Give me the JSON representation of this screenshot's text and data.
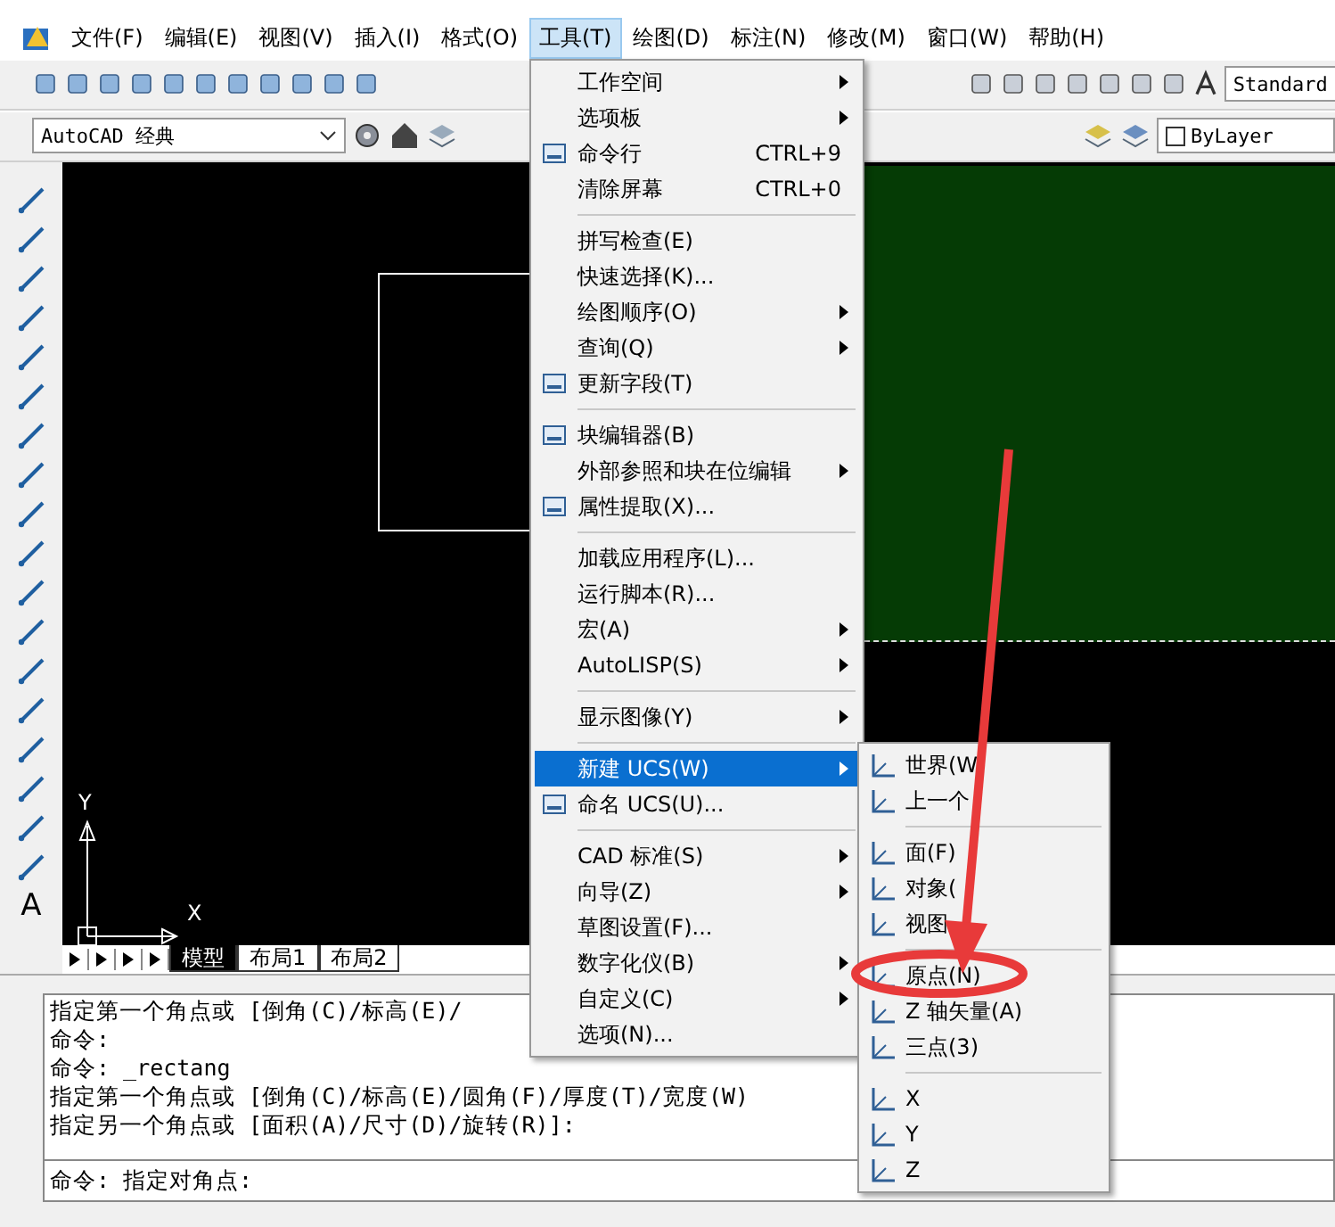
{
  "menu_bar": [
    {
      "label": "文件(F)",
      "selected": false
    },
    {
      "label": "编辑(E)",
      "selected": false
    },
    {
      "label": "视图(V)",
      "selected": false
    },
    {
      "label": "插入(I)",
      "selected": false
    },
    {
      "label": "格式(O)",
      "selected": false
    },
    {
      "label": "工具(T)",
      "selected": true
    },
    {
      "label": "绘图(D)",
      "selected": false
    },
    {
      "label": "标注(N)",
      "selected": false
    },
    {
      "label": "修改(M)",
      "selected": false
    },
    {
      "label": "窗口(W)",
      "selected": false
    },
    {
      "label": "帮助(H)",
      "selected": false
    }
  ],
  "standard_toolbar": {
    "text_style": "Standard"
  },
  "workspace_toolbar": {
    "workspace": "AutoCAD 经典",
    "lineweight": "ByLayer"
  },
  "draw_toolbar": {
    "text_tool": "A"
  },
  "canvas": {
    "ucs_y": "Y",
    "ucs_x": "X"
  },
  "layout_tabs": [
    {
      "label": "模型",
      "selected": true
    },
    {
      "label": "布局1",
      "selected": false
    },
    {
      "label": "布局2",
      "selected": false
    }
  ],
  "command_history": [
    "指定第一个角点或 [倒角(C)/标高(E)/",
    "命令:",
    "命令: _rectang",
    "指定第一个角点或 [倒角(C)/标高(E)/圆角(F)/厚度(T)/宽度(W)",
    "指定另一个角点或 [面积(A)/尺寸(D)/旋转(R)]:"
  ],
  "command_prompt": "命令: 指定对角点:",
  "tools_menu": [
    {
      "kind": "item",
      "label": "工作空间",
      "has_submenu": true,
      "selected": false
    },
    {
      "kind": "item",
      "label": "选项板",
      "has_submenu": true,
      "selected": false
    },
    {
      "kind": "icon_item",
      "label": "命令行",
      "shortcut": "CTRL+9",
      "has_submenu": false,
      "selected": false
    },
    {
      "kind": "item",
      "label": "清除屏幕",
      "shortcut": "CTRL+0",
      "has_submenu": false,
      "selected": false
    },
    {
      "kind": "separator"
    },
    {
      "kind": "item",
      "label": "拼写检查(E)",
      "has_submenu": false,
      "selected": false
    },
    {
      "kind": "item",
      "label": "快速选择(K)...",
      "has_submenu": false,
      "selected": false
    },
    {
      "kind": "item",
      "label": "绘图顺序(O)",
      "has_submenu": true,
      "selected": false
    },
    {
      "kind": "item",
      "label": "查询(Q)",
      "has_submenu": true,
      "selected": false
    },
    {
      "kind": "icon_item",
      "label": "更新字段(T)",
      "has_submenu": false,
      "selected": false
    },
    {
      "kind": "separator"
    },
    {
      "kind": "icon_item",
      "label": "块编辑器(B)",
      "has_submenu": false,
      "selected": false
    },
    {
      "kind": "item",
      "label": "外部参照和块在位编辑",
      "has_submenu": true,
      "selected": false
    },
    {
      "kind": "icon_item",
      "label": "属性提取(X)...",
      "has_submenu": false,
      "selected": false
    },
    {
      "kind": "separator"
    },
    {
      "kind": "item",
      "label": "加载应用程序(L)...",
      "has_submenu": false,
      "selected": false
    },
    {
      "kind": "item",
      "label": "运行脚本(R)...",
      "has_submenu": false,
      "selected": false
    },
    {
      "kind": "item",
      "label": "宏(A)",
      "has_submenu": true,
      "selected": false
    },
    {
      "kind": "item",
      "label": "AutoLISP(S)",
      "has_submenu": true,
      "selected": false
    },
    {
      "kind": "separator"
    },
    {
      "kind": "item",
      "label": "显示图像(Y)",
      "has_submenu": true,
      "selected": false
    },
    {
      "kind": "separator"
    },
    {
      "kind": "item",
      "label": "新建 UCS(W)",
      "has_submenu": true,
      "selected": true
    },
    {
      "kind": "icon_item",
      "label": "命名 UCS(U)...",
      "has_submenu": false,
      "selected": false
    },
    {
      "kind": "separator"
    },
    {
      "kind": "item",
      "label": "CAD 标准(S)",
      "has_submenu": true,
      "selected": false
    },
    {
      "kind": "item",
      "label": "向导(Z)",
      "has_submenu": true,
      "selected": false
    },
    {
      "kind": "item",
      "label": "草图设置(F)...",
      "has_submenu": false,
      "selected": false
    },
    {
      "kind": "item",
      "label": "数字化仪(B)",
      "has_submenu": true,
      "selected": false
    },
    {
      "kind": "item",
      "label": "自定义(C)",
      "has_submenu": true,
      "selected": false
    },
    {
      "kind": "item",
      "label": "选项(N)...",
      "has_submenu": false,
      "selected": false
    }
  ],
  "ucs_submenu": [
    {
      "kind": "icon_item",
      "label": "世界(W",
      "selected": false
    },
    {
      "kind": "icon_item",
      "label": "上一个",
      "selected": false
    },
    {
      "kind": "separator"
    },
    {
      "kind": "icon_item",
      "label": "面(F)",
      "selected": false
    },
    {
      "kind": "icon_item",
      "label": "对象(",
      "selected": false
    },
    {
      "kind": "icon_item",
      "label": "视图",
      "selected": false
    },
    {
      "kind": "separator"
    },
    {
      "kind": "icon_item",
      "label": "原点(N)",
      "selected": false
    },
    {
      "kind": "icon_item",
      "label": "Z 轴矢量(A)",
      "selected": false
    },
    {
      "kind": "icon_item",
      "label": "三点(3)",
      "selected": false
    },
    {
      "kind": "separator"
    },
    {
      "kind": "icon_item",
      "label": "X",
      "selected": false
    },
    {
      "kind": "icon_item",
      "label": "Y",
      "selected": false
    },
    {
      "kind": "icon_item",
      "label": "Z",
      "selected": false
    }
  ]
}
